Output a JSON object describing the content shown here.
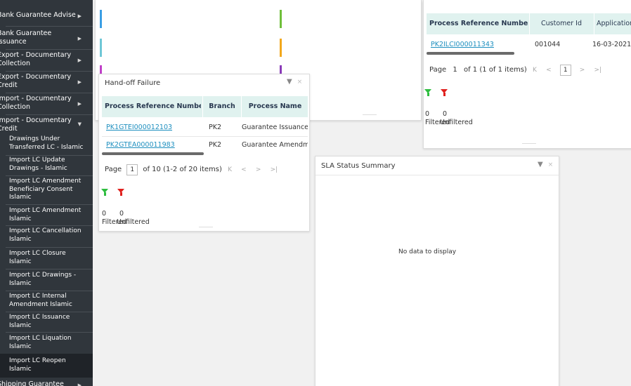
{
  "sidebar": {
    "items": [
      {
        "label": "Bank Guarantee Advise"
      },
      {
        "label": "Bank Guarantee Issuance"
      },
      {
        "label": "Export - Documentary Collection"
      },
      {
        "label": "Export - Documentary Credit"
      },
      {
        "label": "Import - Documentary Collection"
      },
      {
        "label": "Import - Documentary Credit"
      }
    ],
    "subitems": [
      {
        "label": "Drawings Under Transferred LC - Islamic"
      },
      {
        "label": "Import LC Update Drawings - Islamic"
      },
      {
        "label": "Import LC Amendment Beneficiary Consent Islamic"
      },
      {
        "label": "Import LC Amendment Islamic"
      },
      {
        "label": "Import LC Cancellation Islamic"
      },
      {
        "label": "Import LC Closure Islamic"
      },
      {
        "label": "Import LC Drawings - Islamic"
      },
      {
        "label": "Import LC Internal Amendment Islamic"
      },
      {
        "label": "Import LC Issuance Islamic"
      },
      {
        "label": "Import LC Liquation Islamic"
      },
      {
        "label": "Import LC Reopen Islamic"
      }
    ],
    "bottom_item": {
      "label": "Shipping Guarantee"
    }
  },
  "handoff": {
    "title": "Hand-off Failure",
    "columns": [
      "Process Reference Number",
      "Branch",
      "Process Name"
    ],
    "rows": [
      [
        "PK1GTEI000012103",
        "PK2",
        "Guarantee Issuance"
      ],
      [
        "PK2GTEA000011983",
        "PK2",
        "Guarantee Amendment"
      ]
    ],
    "pager": {
      "page_label": "Page",
      "page": "1",
      "of_text": "of 10  (1-2 of 20 items)"
    },
    "filtered_count": "0",
    "unfiltered_count": "0",
    "filtered_label": "Filtered",
    "unfiltered_label": "Unfiltered"
  },
  "topright": {
    "columns": [
      "Process Reference Number",
      "Customer Id",
      "Application Date"
    ],
    "rows": [
      [
        "PK2ILCI000011343",
        "001044",
        "16-03-2021"
      ]
    ],
    "pager": {
      "page_label": "Page",
      "page": "1",
      "of_text": "of 1  (1 of 1 items)",
      "box_value": "1"
    },
    "filtered_count": "0",
    "unfiltered_count": "0",
    "filtered_label": "Filtered",
    "unfiltered_label": "Unfiltered"
  },
  "sla": {
    "title": "SLA Status Summary",
    "empty_text": "No data to display"
  },
  "icons": {
    "filter": "filter-icon",
    "close": "close-icon",
    "arrow_right": "chevron-right-icon",
    "arrow_down": "chevron-down-icon"
  },
  "colors": {
    "sidebar_bg": "#30363c",
    "header_bg": "#e0f2ef",
    "link": "#1e8fbf",
    "filter_green": "#2ebd3f",
    "filter_red": "#e0201d"
  }
}
